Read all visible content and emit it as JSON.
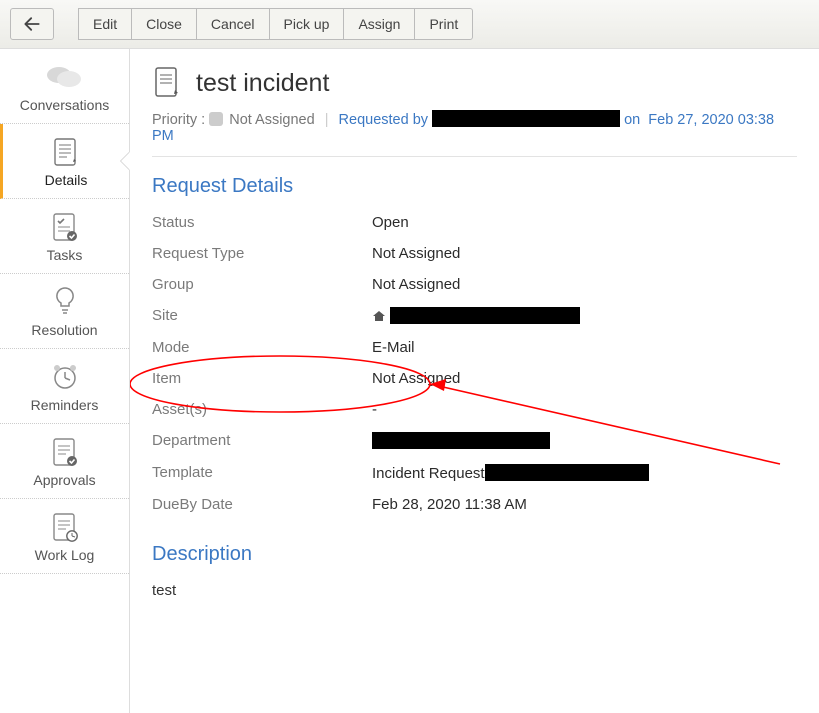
{
  "toolbar": {
    "back": "←",
    "buttons": [
      "Edit",
      "Close",
      "Cancel",
      "Pick up",
      "Assign",
      "Print"
    ]
  },
  "sidebar": {
    "items": [
      {
        "label": "Conversations"
      },
      {
        "label": "Details"
      },
      {
        "label": "Tasks"
      },
      {
        "label": "Resolution"
      },
      {
        "label": "Reminders"
      },
      {
        "label": "Approvals"
      },
      {
        "label": "Work Log"
      }
    ]
  },
  "header": {
    "title": "test incident",
    "priority_label": "Priority :",
    "priority_value": "Not Assigned",
    "requested_by_label": "Requested by",
    "on_label": "on",
    "requested_on": "Feb 27, 2020 03:38 PM"
  },
  "request_details": {
    "heading": "Request Details",
    "rows": {
      "status": {
        "k": "Status",
        "v": "Open"
      },
      "request_type": {
        "k": "Request Type",
        "v": "Not Assigned"
      },
      "group": {
        "k": "Group",
        "v": "Not Assigned"
      },
      "site": {
        "k": "Site",
        "v": ""
      },
      "mode": {
        "k": "Mode",
        "v": "E-Mail"
      },
      "item": {
        "k": "Item",
        "v": "Not Assigned"
      },
      "assets": {
        "k": "Asset(s)",
        "v": "-"
      },
      "department": {
        "k": "Department",
        "v": ""
      },
      "template": {
        "k": "Template",
        "v": "Incident Request"
      },
      "dueby": {
        "k": "DueBy Date",
        "v": "Feb 28, 2020 11:38 AM"
      }
    }
  },
  "description": {
    "heading": "Description",
    "body": "test"
  }
}
